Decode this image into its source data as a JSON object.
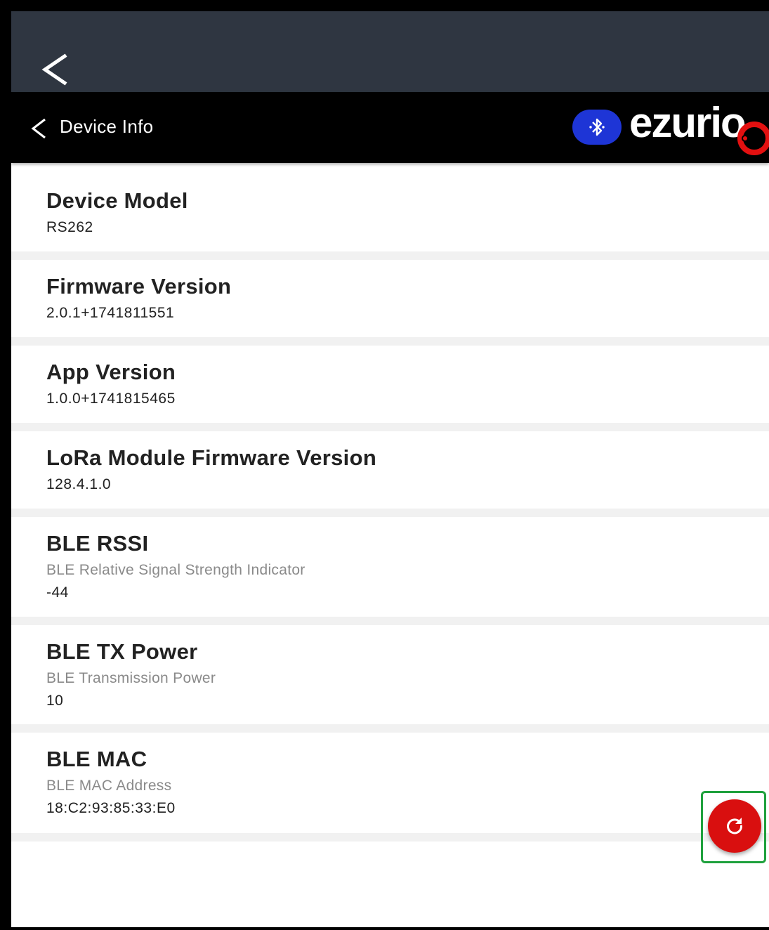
{
  "appbar": {
    "title": "Device Info",
    "brand_logo_text": "ezurio",
    "brand_colors": {
      "logo_text": "#ffffff",
      "logo_dot": "#e31010"
    },
    "bluetooth_color": "#1e35d6"
  },
  "items": [
    {
      "label": "Device Model",
      "desc": "",
      "value": "RS262"
    },
    {
      "label": "Firmware Version",
      "desc": "",
      "value": "2.0.1+1741811551"
    },
    {
      "label": "App Version",
      "desc": "",
      "value": "1.0.0+1741815465"
    },
    {
      "label": "LoRa Module Firmware Version",
      "desc": "",
      "value": "128.4.1.0"
    },
    {
      "label": "BLE RSSI",
      "desc": "BLE Relative Signal Strength Indicator",
      "value": "-44"
    },
    {
      "label": "BLE TX Power",
      "desc": "BLE Transmission Power",
      "value": "10"
    },
    {
      "label": "BLE MAC",
      "desc": "BLE MAC Address",
      "value": "18:C2:93:85:33:E0"
    }
  ],
  "icons": {
    "system_back": "chevron-left-icon",
    "appbar_back": "chevron-left-icon",
    "bluetooth": "bluetooth-icon",
    "refresh": "refresh-icon"
  },
  "fab": {
    "color": "#d90f0f",
    "highlight_color": "#1fa13d"
  }
}
